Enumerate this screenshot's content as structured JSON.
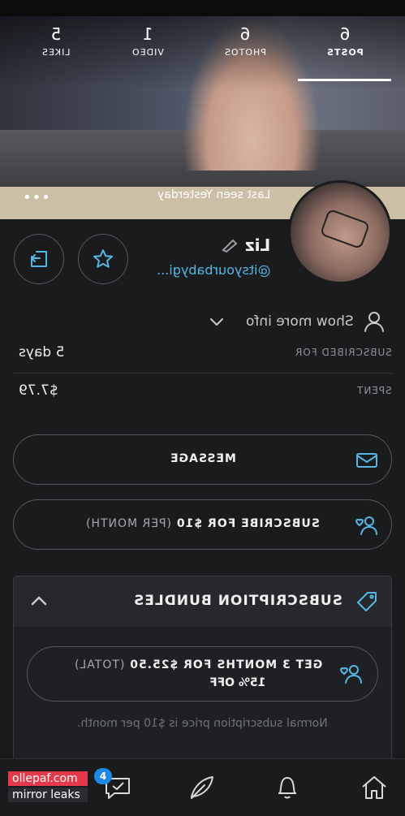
{
  "profile": {
    "stats": [
      {
        "count": "6",
        "label": "POSTS",
        "active": true
      },
      {
        "count": "6",
        "label": "PHOTOS",
        "active": false
      },
      {
        "count": "1",
        "label": "VIDEO",
        "active": false
      },
      {
        "count": "5",
        "label": "LIKES",
        "active": false
      }
    ],
    "last_seen": "Last seen Yesterday",
    "more": "•••",
    "name": "Liz",
    "handle": "@itsyourbabygi...",
    "show_more": "Show more info"
  },
  "details": [
    {
      "key": "SUBSCRIBED FOR",
      "value": "5 days"
    },
    {
      "key": "SPENT",
      "value": "$7.79"
    }
  ],
  "buttons": {
    "message": "MESSAGE",
    "subscribe_main": "SUBSCRIBE FOR $10",
    "subscribe_sub": "(PER MONTH)"
  },
  "bundles": {
    "title": "SUBSCRIPTION BUNDLES",
    "offer_line1": "GET 3 MONTHS FOR $25.50",
    "offer_total": "(TOTAL)",
    "offer_line2": "15% OFF",
    "note": "Normal subscription price is $10 per month."
  },
  "nav": {
    "messages_badge": "4"
  },
  "watermark": {
    "line1": "ollepaf.com",
    "line2": "mirror leaks"
  },
  "colors": {
    "accent": "#53b7e8",
    "background": "#1a1b1d",
    "badge": "#1e88e5"
  }
}
